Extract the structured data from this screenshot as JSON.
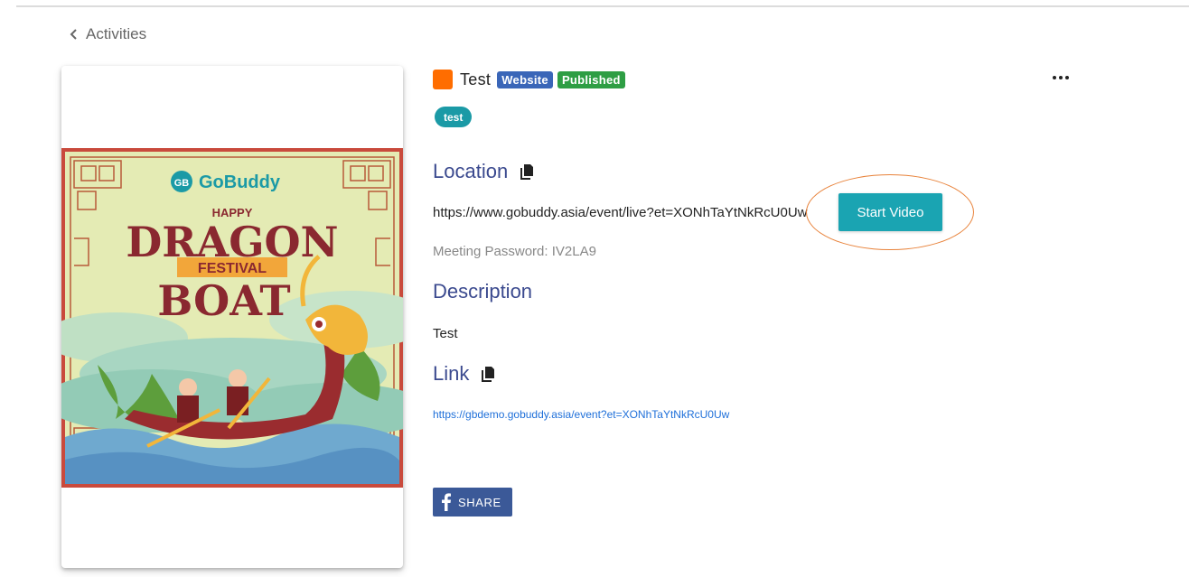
{
  "nav": {
    "back_label": "Activities"
  },
  "event": {
    "title": "Test",
    "color": "#ff6d00",
    "badges": {
      "website": "Website",
      "published": "Published"
    },
    "tag": "test"
  },
  "poster": {
    "brand": "GoBuddy",
    "logo_mark": "GB",
    "line1": "HAPPY",
    "line2": "DRAGON",
    "line3": "FESTIVAL",
    "line4": "BOAT"
  },
  "location": {
    "heading": "Location",
    "url": "https://www.gobuddy.asia/event/live?et=XONhTaYtNkRcU0Uw",
    "start_button": "Start Video",
    "password": "Meeting Password: IV2LA9"
  },
  "description": {
    "heading": "Description",
    "text": "Test"
  },
  "link": {
    "heading": "Link",
    "url": "https://gbdemo.gobuddy.asia/event?et=XONhTaYtNkRcU0Uw"
  },
  "share": {
    "label": "SHARE"
  },
  "icons": {
    "back": "chevron-left-icon",
    "copy": "copy-icon",
    "more": "more-horizontal-icon",
    "facebook": "facebook-icon"
  },
  "colors": {
    "accent": "#1aa4b2",
    "heading": "#3b4a8f",
    "website": "#3a66b8",
    "published": "#2e9e44",
    "facebook": "#3b5998",
    "highlight": "#e8823a"
  }
}
